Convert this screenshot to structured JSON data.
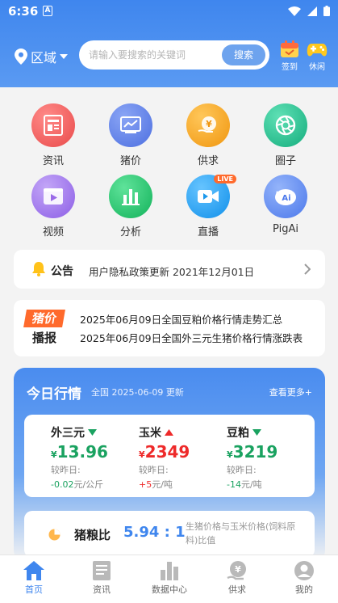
{
  "status_bar": {
    "time": "6:36",
    "a_icon": "A"
  },
  "header": {
    "region_label": "区域",
    "search_placeholder": "请输入要搜索的关键词",
    "search_button": "搜索",
    "checkin_label": "签到",
    "leisure_label": "休闲"
  },
  "grid": [
    {
      "label": "资讯",
      "icon": "news-icon",
      "color": "#ee5a59"
    },
    {
      "label": "猪价",
      "icon": "chart-icon",
      "color": "#5b7fe8"
    },
    {
      "label": "供求",
      "icon": "yen-icon",
      "color": "#f3a51e"
    },
    {
      "label": "圈子",
      "icon": "aperture-icon",
      "color": "#1fbf8f"
    },
    {
      "label": "视频",
      "icon": "video-icon",
      "color": "#9a6ae8"
    },
    {
      "label": "分析",
      "icon": "bars-icon",
      "color": "#21c46a"
    },
    {
      "label": "直播",
      "icon": "camera-icon",
      "color": "#2aa2ee",
      "badge": "LIVE"
    },
    {
      "label": "PigAi",
      "icon": "pig-ai-icon",
      "color": "#5c8af0"
    }
  ],
  "notice": {
    "title": "公告",
    "text": "用户隐私政策更新 2021年12月01日"
  },
  "news": {
    "badge_top": "猪价",
    "badge_bottom": "播报",
    "items": [
      "2025年06月09日全国豆粕价格行情走势汇总",
      "2025年06月09日全国外三元生猪价格行情涨跌表"
    ]
  },
  "market": {
    "title": "今日行情",
    "subtitle": "全国 2025-06-09 更新",
    "more": "查看更多+",
    "prices": [
      {
        "name": "外三元",
        "trend": "down",
        "currency": "¥",
        "value": "13.96",
        "compare_label": "较昨日:",
        "change": "-0.02",
        "unit": "元/公斤"
      },
      {
        "name": "玉米",
        "trend": "up",
        "currency": "¥",
        "value": "2349",
        "compare_label": "较昨日:",
        "change": "+5",
        "unit": "元/吨"
      },
      {
        "name": "豆粕",
        "trend": "down",
        "currency": "¥",
        "value": "3219",
        "compare_label": "较昨日:",
        "change": "-14",
        "unit": "元/吨"
      }
    ],
    "ratio": {
      "label": "猪粮比",
      "value": "5.94 : 1",
      "description": "生猪价格与玉米价格(饲料原料)比值"
    }
  },
  "tabbar": [
    {
      "label": "首页",
      "active": true
    },
    {
      "label": "资讯",
      "active": false
    },
    {
      "label": "数据中心",
      "active": false
    },
    {
      "label": "供求",
      "active": false
    },
    {
      "label": "我的",
      "active": false
    }
  ],
  "colors": {
    "primary": "#3f86ee",
    "up": "#ee2a2a",
    "down": "#1aa260"
  }
}
